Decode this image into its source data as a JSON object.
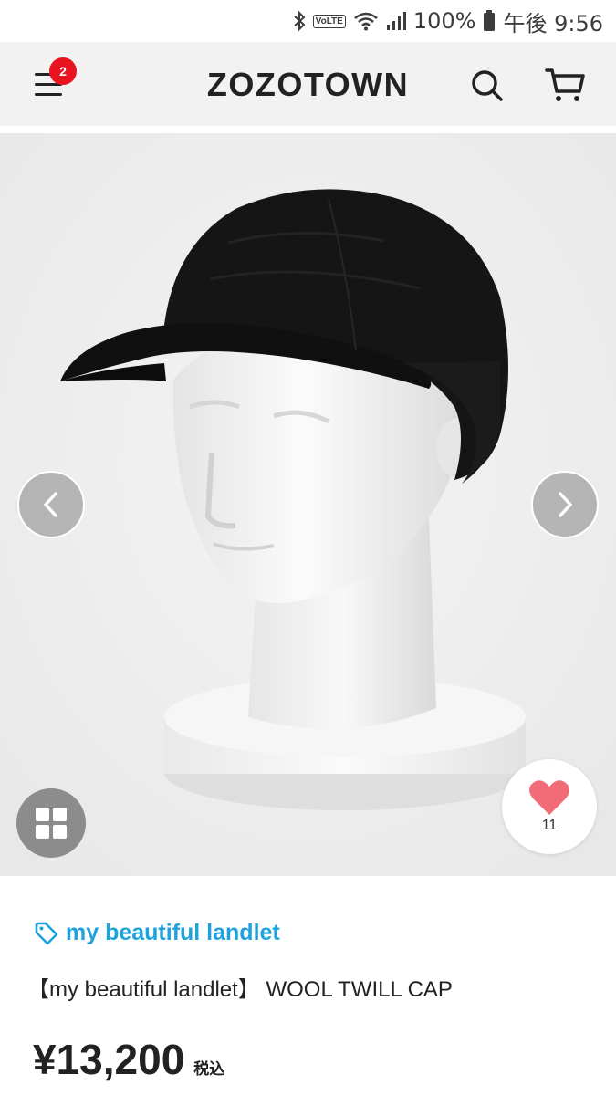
{
  "status_bar": {
    "volte": "VoLTE",
    "battery_percent": "100%",
    "time": "午後 9:56"
  },
  "header": {
    "logo": "ZOZOTOWN",
    "menu_badge_count": "2",
    "icons": [
      "menu-icon",
      "search-icon",
      "cart-icon"
    ]
  },
  "product": {
    "favorite_count": "11",
    "brand": "my beautiful landlet",
    "name": "【my beautiful landlet】 WOOL TWILL CAP",
    "price": "¥13,200",
    "tax_label": "税込"
  },
  "colors": {
    "accent_link": "#1fa3dc",
    "badge": "#e8141f",
    "heart": "#f26c78"
  }
}
